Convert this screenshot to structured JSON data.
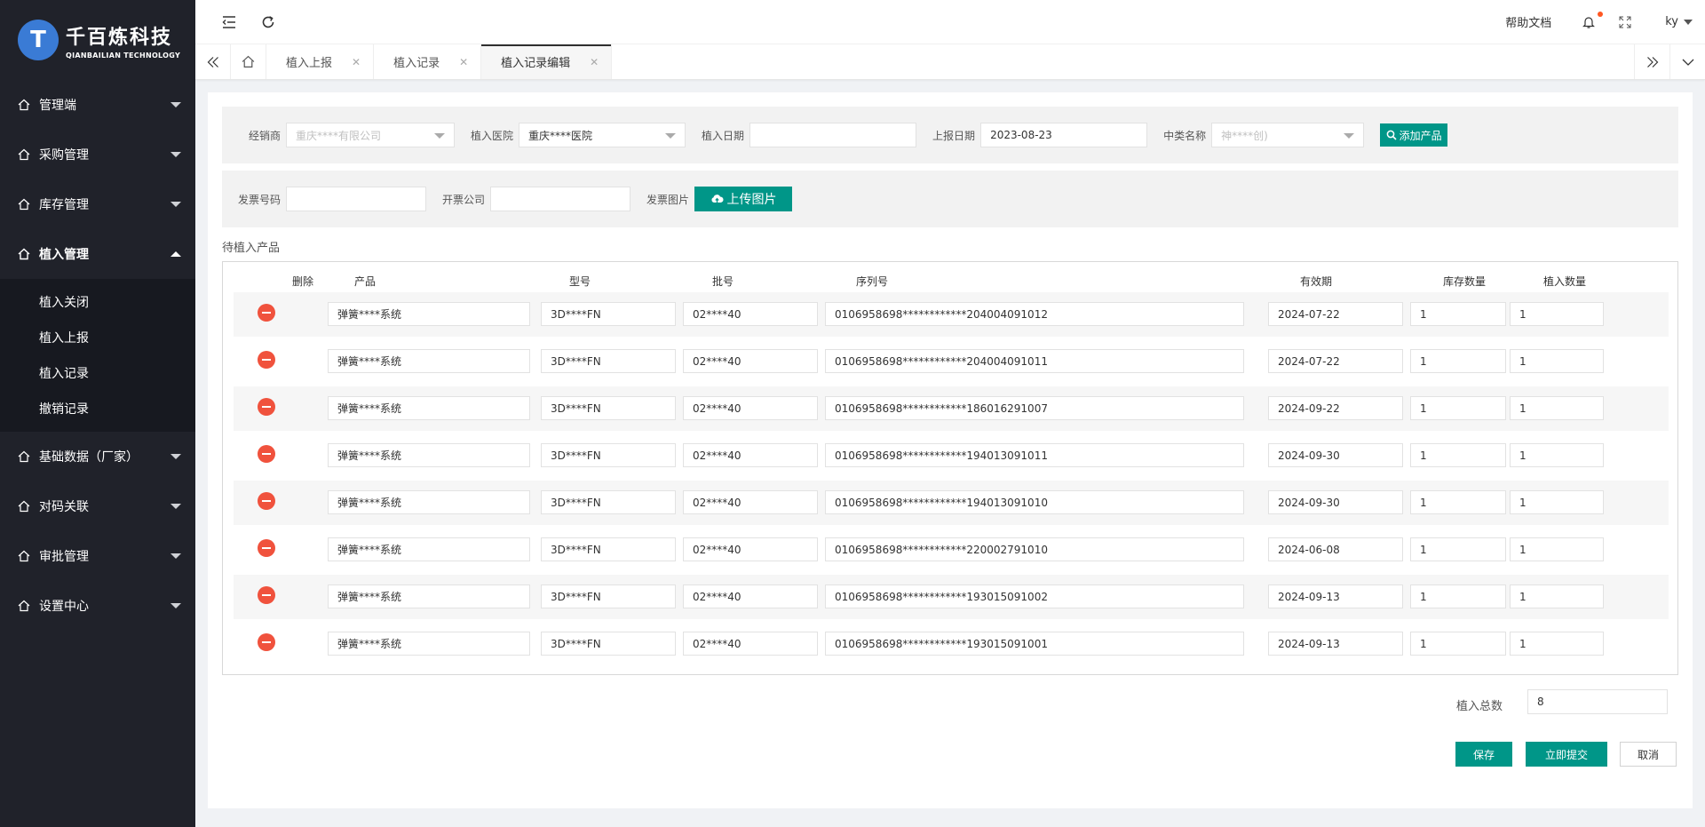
{
  "brand": {
    "name_cn": "千百炼科技",
    "name_en": "QIANBAILIAN TECHNOLOGY",
    "logo_glyph": "T",
    "accent": "#3a7bd5"
  },
  "sidebar": {
    "menu_top": [
      {
        "label": "管理端",
        "icon": "home-icon"
      },
      {
        "label": "采购管理",
        "icon": "home-icon"
      },
      {
        "label": "库存管理",
        "icon": "home-icon"
      },
      {
        "label": "植入管理",
        "icon": "home-icon",
        "expanded": true
      }
    ],
    "submenu": [
      "植入关闭",
      "植入上报",
      "植入记录",
      "撤销记录"
    ],
    "menu_bottom": [
      {
        "label": "基础数据（厂家）",
        "icon": "home-icon"
      },
      {
        "label": "对码关联",
        "icon": "home-icon"
      },
      {
        "label": "审批管理",
        "icon": "home-icon"
      },
      {
        "label": "设置中心",
        "icon": "home-icon"
      }
    ]
  },
  "header": {
    "help": "帮助文档",
    "user": "ky"
  },
  "tabs": [
    {
      "label": "植入上报",
      "active": false
    },
    {
      "label": "植入记录",
      "active": false
    },
    {
      "label": "植入记录编辑",
      "active": true
    }
  ],
  "filters": {
    "dealer_label": "经销商",
    "dealer_value": "重庆****有限公司",
    "hospital_label": "植入医院",
    "hospital_value": "重庆****医院",
    "implant_date_label": "植入日期",
    "implant_date_value": "",
    "report_date_label": "上报日期",
    "report_date_value": "2023-08-23",
    "category_label": "中类名称",
    "category_value": "神****创)",
    "add_product": "添加产品",
    "invoice_no_label": "发票号码",
    "invoice_no_value": "",
    "invoice_company_label": "开票公司",
    "invoice_company_value": "",
    "invoice_image_label": "发票图片",
    "upload": "上传图片"
  },
  "section_title": "待植入产品",
  "table": {
    "headers": {
      "delete": "删除",
      "product": "产品",
      "model": "型号",
      "batch": "批号",
      "serial": "序列号",
      "expiry": "有效期",
      "stock_qty": "库存数量",
      "implant_qty": "植入数量"
    },
    "rows": [
      {
        "product": "弹簧****系统",
        "model": "3D****FN",
        "batch": "02****40",
        "serial": "0106958698************204004091012",
        "expiry": "2024-07-22",
        "stock_qty": "1",
        "implant_qty": "1"
      },
      {
        "product": "弹簧****系统",
        "model": "3D****FN",
        "batch": "02****40",
        "serial": "0106958698************204004091011",
        "expiry": "2024-07-22",
        "stock_qty": "1",
        "implant_qty": "1"
      },
      {
        "product": "弹簧****系统",
        "model": "3D****FN",
        "batch": "02****40",
        "serial": "0106958698************186016291007",
        "expiry": "2024-09-22",
        "stock_qty": "1",
        "implant_qty": "1"
      },
      {
        "product": "弹簧****系统",
        "model": "3D****FN",
        "batch": "02****40",
        "serial": "0106958698************194013091011",
        "expiry": "2024-09-30",
        "stock_qty": "1",
        "implant_qty": "1"
      },
      {
        "product": "弹簧****系统",
        "model": "3D****FN",
        "batch": "02****40",
        "serial": "0106958698************194013091010",
        "expiry": "2024-09-30",
        "stock_qty": "1",
        "implant_qty": "1"
      },
      {
        "product": "弹簧****系统",
        "model": "3D****FN",
        "batch": "02****40",
        "serial": "0106958698************220002791010",
        "expiry": "2024-06-08",
        "stock_qty": "1",
        "implant_qty": "1"
      },
      {
        "product": "弹簧****系统",
        "model": "3D****FN",
        "batch": "02****40",
        "serial": "0106958698************193015091002",
        "expiry": "2024-09-13",
        "stock_qty": "1",
        "implant_qty": "1"
      },
      {
        "product": "弹簧****系统",
        "model": "3D****FN",
        "batch": "02****40",
        "serial": "0106958698************193015091001",
        "expiry": "2024-09-13",
        "stock_qty": "1",
        "implant_qty": "1"
      }
    ]
  },
  "footer": {
    "total_label": "植入总数",
    "total_value": "8",
    "save": "保存",
    "submit": "立即提交",
    "cancel": "取消"
  },
  "colors": {
    "primary": "#009688",
    "danger": "#f0523d",
    "sidebar_bg": "#20222a"
  }
}
